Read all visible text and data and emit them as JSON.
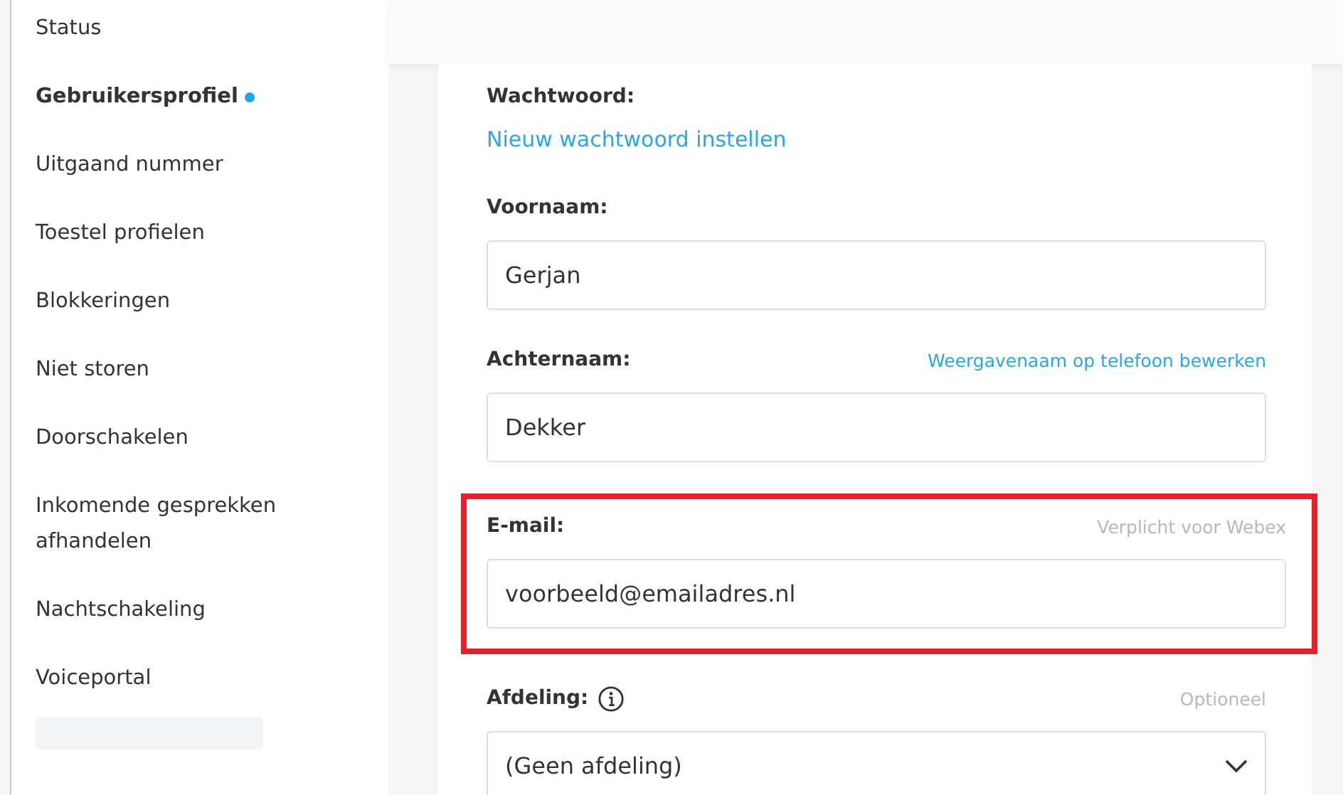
{
  "sidebar": {
    "items": [
      {
        "label": "Status",
        "selected": false
      },
      {
        "label": "Gebruikersprofiel",
        "selected": true
      },
      {
        "label": "Uitgaand nummer",
        "selected": false
      },
      {
        "label": "Toestel profielen",
        "selected": false
      },
      {
        "label": "Blokkeringen",
        "selected": false
      },
      {
        "label": "Niet storen",
        "selected": false
      },
      {
        "label": "Doorschakelen",
        "selected": false
      },
      {
        "label": "Inkomende gesprekken afhandelen",
        "selected": false
      },
      {
        "label": "Nachtschakeling",
        "selected": false
      },
      {
        "label": "Voiceportal",
        "selected": false
      }
    ]
  },
  "form": {
    "fields": [
      {
        "kind": "link",
        "label": "Wachtwoord:",
        "value": "Nieuw wachtwoord instellen",
        "highlighted": false
      },
      {
        "kind": "text",
        "label": "Voornaam:",
        "value": "Gerjan",
        "highlighted": false
      },
      {
        "kind": "text",
        "label": "Achternaam:",
        "side_link": "Weergavenaam op telefoon bewerken",
        "value": "Dekker",
        "highlighted": false
      },
      {
        "kind": "text",
        "label": "E-mail:",
        "hint": "Verplicht voor Webex",
        "value": "voorbeeld@emailadres.nl",
        "highlighted": true
      },
      {
        "kind": "select",
        "label": "Afdeling:",
        "info": true,
        "hint": "Optioneel",
        "value": "(Geen afdeling)",
        "highlighted": false
      }
    ]
  }
}
